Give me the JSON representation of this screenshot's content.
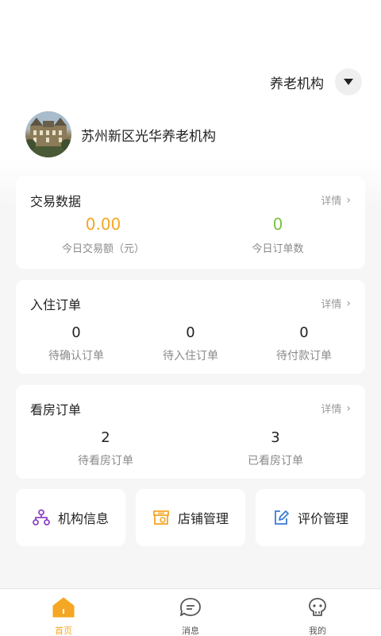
{
  "header": {
    "org_type_label": "养老机构"
  },
  "profile": {
    "name": "苏州新区光华养老机构"
  },
  "trade_card": {
    "title": "交易数据",
    "detail_label": "详情",
    "today_amount_value": "0.00",
    "today_amount_label": "今日交易额（元）",
    "today_orders_value": "0",
    "today_orders_label": "今日订单数",
    "amount_color": "#f5a623",
    "orders_color": "#7ac142"
  },
  "checkin_card": {
    "title": "入住订单",
    "detail_label": "详情",
    "stats": [
      {
        "value": "0",
        "label": "待确认订单"
      },
      {
        "value": "0",
        "label": "待入住订单"
      },
      {
        "value": "0",
        "label": "待付款订单"
      }
    ]
  },
  "viewing_card": {
    "title": "看房订单",
    "detail_label": "详情",
    "stats": [
      {
        "value": "2",
        "label": "待看房订单"
      },
      {
        "value": "3",
        "label": "已看房订单"
      }
    ]
  },
  "quick_actions": [
    {
      "label": "机构信息",
      "icon": "org-structure-icon",
      "color": "#8e44c7"
    },
    {
      "label": "店铺管理",
      "icon": "store-icon",
      "color": "#f5a623"
    },
    {
      "label": "评价管理",
      "icon": "edit-review-icon",
      "color": "#3a7bd5"
    }
  ],
  "tabbar": {
    "items": [
      {
        "label": "首页",
        "icon": "home-icon",
        "active": true
      },
      {
        "label": "消息",
        "icon": "message-icon",
        "active": false
      },
      {
        "label": "我的",
        "icon": "profile-icon",
        "active": false
      }
    ],
    "active_color": "#f5a623"
  }
}
